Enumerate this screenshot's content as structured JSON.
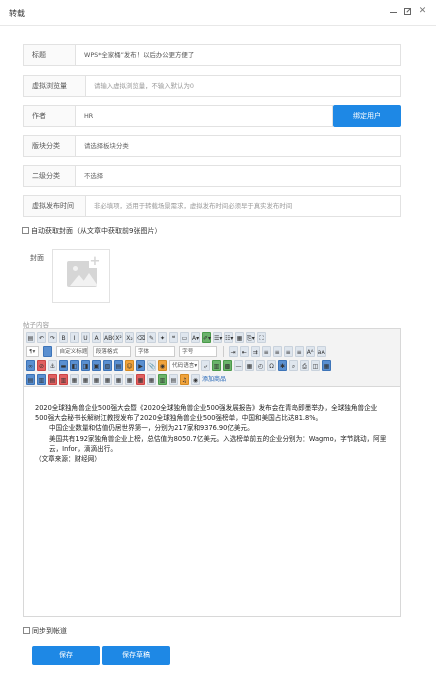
{
  "window": {
    "title": "转载"
  },
  "form": {
    "title": {
      "label": "标题",
      "value": "WPS*全家桶”发布！以后办公更方便了"
    },
    "views": {
      "label": "虚拟浏览量",
      "placeholder": "请输入虚拟浏览量，不输入默认为0"
    },
    "author": {
      "label": "作者",
      "value": "HR",
      "bind_button": "绑定用户"
    },
    "section": {
      "label": "版块分类",
      "value": "请选择板块分类"
    },
    "subcategory": {
      "label": "二级分类",
      "value": "不选择"
    },
    "publish_time": {
      "label": "虚拟发布时间",
      "placeholder": "非必填项，适用于转载场景需求，虚拟发布时间必须早于真实发布时间"
    },
    "auto_cover": {
      "label": "自动获取封面（从文章中获取前9张图片）"
    },
    "cover": {
      "label": "封面"
    },
    "content": {
      "label": "帖子内容"
    },
    "sync": {
      "label": "同步到帐道"
    }
  },
  "toolbar": {
    "row1": [
      {
        "name": "source-icon",
        "text": "▤"
      },
      {
        "name": "undo-icon",
        "text": "↶"
      },
      {
        "name": "redo-icon",
        "text": "↷"
      },
      {
        "name": "bold-button",
        "text": "B"
      },
      {
        "name": "italic-button",
        "text": "I"
      },
      {
        "name": "underline-button",
        "text": "U"
      },
      {
        "name": "font-border-button",
        "text": "A"
      },
      {
        "name": "strikethrough-button",
        "text": "ABC"
      },
      {
        "name": "superscript-button",
        "text": "X²"
      },
      {
        "name": "subscript-button",
        "text": "X₂"
      },
      {
        "name": "eraser-icon",
        "text": "⌫"
      },
      {
        "name": "format-brush-icon",
        "text": "✎"
      },
      {
        "name": "auto-format-icon",
        "text": "✦"
      },
      {
        "name": "blockquote-icon",
        "text": "❝"
      },
      {
        "name": "code-icon",
        "text": "▭"
      },
      {
        "name": "font-color-button",
        "text": "A▾"
      },
      {
        "name": "background-color-button",
        "text": "✐▾"
      },
      {
        "name": "ordered-list-button",
        "text": "☰▾"
      },
      {
        "name": "unordered-list-button",
        "text": "☷▾"
      },
      {
        "name": "select-all-icon",
        "text": "▦"
      },
      {
        "name": "clear-doc-icon",
        "text": "⎘▾"
      },
      {
        "name": "fullscreen-icon",
        "text": "⛶"
      }
    ],
    "row2_combos": {
      "paragraph": "¶▾",
      "custom_title": "自定义标题",
      "paragraph_format": "段落格式",
      "font_family": "字体",
      "font_size": "字号"
    },
    "row2_tail": [
      {
        "name": "ltr-icon",
        "text": "⇥"
      },
      {
        "name": "rtl-icon",
        "text": "⇤"
      },
      {
        "name": "indent-icon",
        "text": "⇉"
      },
      {
        "name": "align-left-icon",
        "text": "≡"
      },
      {
        "name": "align-center-icon",
        "text": "≡"
      },
      {
        "name": "align-right-icon",
        "text": "≡"
      },
      {
        "name": "justify-icon",
        "text": "≡"
      },
      {
        "name": "touppercase-icon",
        "text": "Aᴬ"
      },
      {
        "name": "tolowercase-icon",
        "text": "aᴀ"
      }
    ],
    "row3": [
      {
        "name": "link-icon",
        "text": "∞"
      },
      {
        "name": "unlink-icon",
        "text": "⊘"
      },
      {
        "name": "anchor-icon",
        "text": "⚓"
      },
      {
        "name": "image-float-none-icon",
        "text": "▬"
      },
      {
        "name": "image-float-left-icon",
        "text": "◧"
      },
      {
        "name": "image-float-right-icon",
        "text": "◨"
      },
      {
        "name": "image-center-icon",
        "text": "▣"
      },
      {
        "name": "insert-image-icon",
        "text": "▧"
      },
      {
        "name": "multi-image-icon",
        "text": "▤"
      },
      {
        "name": "emotion-icon",
        "text": "☺"
      },
      {
        "name": "video-icon",
        "text": "▶"
      },
      {
        "name": "attachment-icon",
        "text": "📎"
      },
      {
        "name": "map-icon",
        "text": "◉"
      },
      {
        "name": "code-insert-button",
        "text": "代码语言▾"
      },
      {
        "name": "page-break-icon",
        "text": "⤶"
      },
      {
        "name": "template-icon",
        "text": "▥"
      },
      {
        "name": "background-icon",
        "text": "▩"
      },
      {
        "name": "horizontal-rule-icon",
        "text": "—"
      },
      {
        "name": "date-icon",
        "text": "▦"
      },
      {
        "name": "time-icon",
        "text": "◴"
      },
      {
        "name": "special-char-icon",
        "text": "Ω"
      },
      {
        "name": "word-image-icon",
        "text": "✱"
      },
      {
        "name": "search-replace-icon",
        "text": "⌕"
      },
      {
        "name": "print-icon",
        "text": "⎙"
      },
      {
        "name": "preview-icon",
        "text": "◫"
      },
      {
        "name": "insert-table-icon",
        "text": "▦"
      }
    ],
    "row4": [
      {
        "name": "insert-row-icon",
        "text": "▤"
      },
      {
        "name": "insert-col-icon",
        "text": "▥"
      },
      {
        "name": "delete-row-icon",
        "text": "▤"
      },
      {
        "name": "delete-col-icon",
        "text": "▥"
      },
      {
        "name": "merge-cells-icon",
        "text": "▦"
      },
      {
        "name": "merge-right-icon",
        "text": "▦"
      },
      {
        "name": "merge-down-icon",
        "text": "▦"
      },
      {
        "name": "split-cells-icon",
        "text": "▦"
      },
      {
        "name": "split-rows-icon",
        "text": "▦"
      },
      {
        "name": "split-cols-icon",
        "text": "▦"
      },
      {
        "name": "delete-table-icon",
        "text": "▦"
      },
      {
        "name": "table-attr-icon",
        "text": "▦"
      },
      {
        "name": "chart-icon",
        "text": "▥"
      },
      {
        "name": "draft-icon",
        "text": "▤"
      },
      {
        "name": "music-icon",
        "text": "♫"
      },
      {
        "name": "add-product-icon",
        "text": "◉"
      }
    ],
    "add_product_label": "添加商品"
  },
  "article": {
    "p1": "2020全球独角兽企业500强大会暨《2020全球独角兽企业500强发展报告》发布会在青岛即墨举办，全球独角兽企业500强大会秘书长解树江教授发布了2020全球独角兽企业500强榜单，中国和美国占比达81.8%。",
    "p2": "中国企业数量和估值仍居世界第一，分别为217家和9376.90亿美元。",
    "p3": "美国共有192家独角兽企业上榜，总估值为8050.7亿美元。入选榜单前五的企业分别为：Wagmo，字节跳动，阿里云，Infor，滴滴出行。",
    "p4": "（文章来源：财经网）"
  },
  "buttons": {
    "save": "保存",
    "save_draft": "保存草稿"
  },
  "colors": {
    "primary": "#1e88e5"
  }
}
